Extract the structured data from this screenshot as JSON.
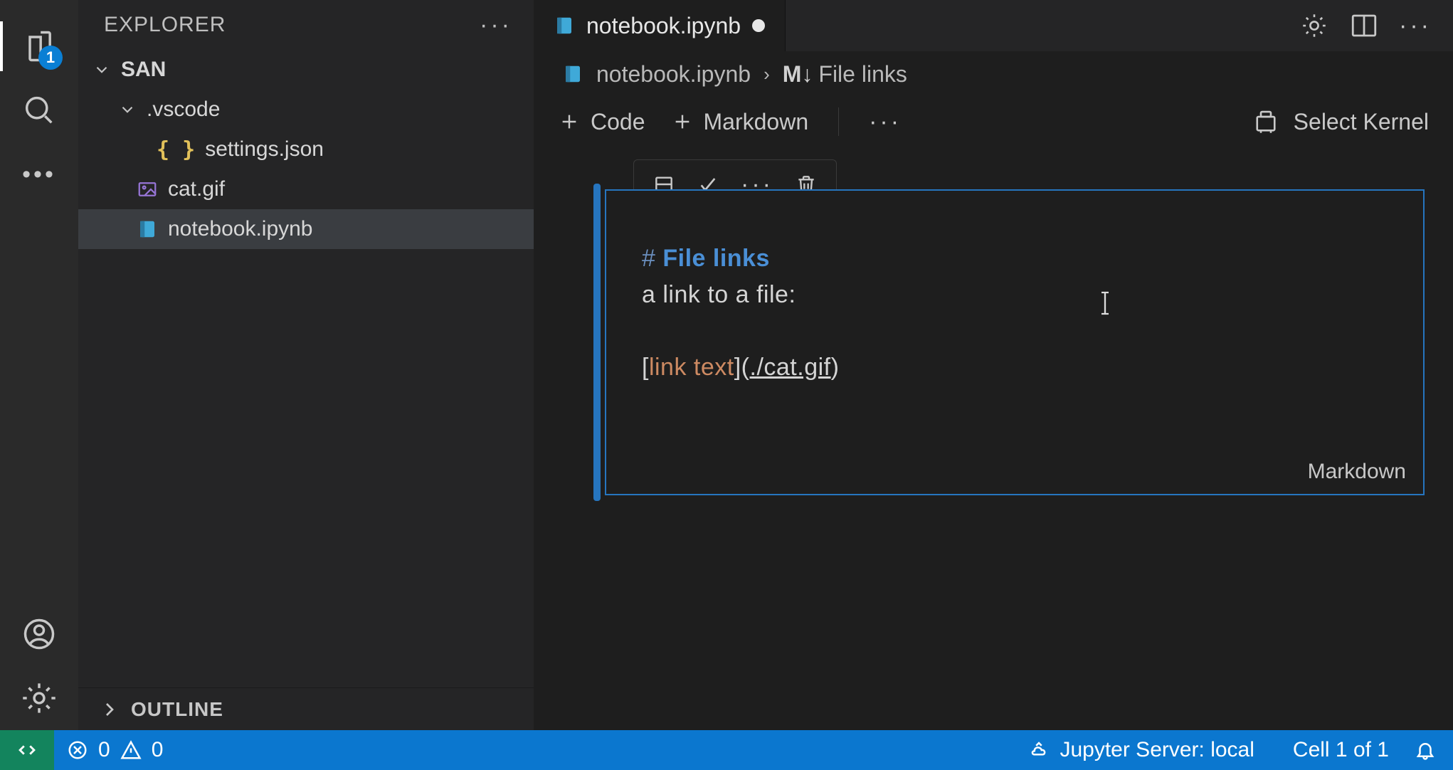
{
  "explorer": {
    "title": "EXPLORER",
    "root": "SAN",
    "tree": [
      {
        "name": ".vscode",
        "kind": "folder",
        "expanded": true,
        "depth": 0
      },
      {
        "name": "settings.json",
        "kind": "json",
        "depth": 1
      },
      {
        "name": "cat.gif",
        "kind": "image",
        "depth": 0
      },
      {
        "name": "notebook.ipynb",
        "kind": "notebook",
        "depth": 0,
        "selected": true
      }
    ],
    "outline": "OUTLINE"
  },
  "activity_badge": "1",
  "tab": {
    "label": "notebook.ipynb",
    "dirty": true
  },
  "breadcrumb": {
    "file": "notebook.ipynb",
    "symbol_prefix": "M↓",
    "symbol": "File links"
  },
  "toolbar": {
    "add_code": "Code",
    "add_markdown": "Markdown",
    "select_kernel": "Select Kernel"
  },
  "cell": {
    "language": "Markdown",
    "line1_prefix": "#",
    "line1_heading": "File links",
    "line2": "a link to a file:",
    "link_text": "link text",
    "link_path": "./cat.gif"
  },
  "status": {
    "errors": "0",
    "warnings": "0",
    "server": "Jupyter Server: local",
    "cell": "Cell 1 of 1"
  }
}
